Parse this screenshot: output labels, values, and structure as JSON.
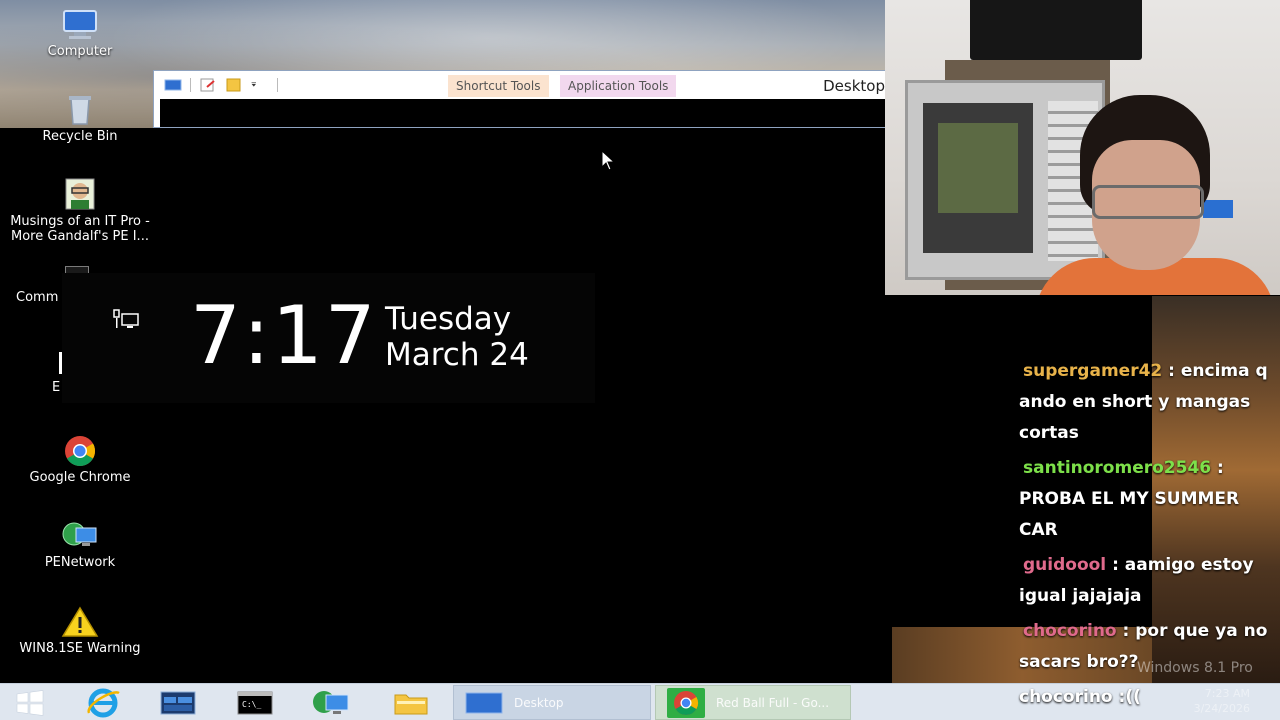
{
  "desktop_icons": {
    "computer": "Computer",
    "recycle_bin": "Recycle Bin",
    "musings": "Musings of an IT Pro - More Gandalf's PE I...",
    "commands": "Comm",
    "partial": "E",
    "chrome": "Google Chrome",
    "penetwork": "PENetwork",
    "warning": "WIN8.1SE Warning"
  },
  "explorer": {
    "shortcut_tools": "Shortcut Tools",
    "application_tools": "Application Tools",
    "title": "Desktop"
  },
  "clock": {
    "time": "7:17",
    "day": "Tuesday",
    "date": "March 24"
  },
  "chat": {
    "messages": [
      {
        "user": "supergamer42",
        "text": ": encima q ando en short y mangas cortas",
        "color": "#e8b34a"
      },
      {
        "user": "santinoromero2546",
        "text": ": PROBA EL MY SUMMER CAR",
        "color": "#7de04a"
      },
      {
        "user": "guidoool",
        "text": ": aamigo estoy igual jajajaja",
        "color": "#e06a8c"
      },
      {
        "user": "chocorino",
        "text": ": por que ya no sacars bro??",
        "color": "#e06a8c"
      }
    ],
    "last": "chocorino :(("
  },
  "watermark": "Windows 8.1 Pro",
  "taskbar": {
    "desktop_task": "Desktop",
    "chrome_task": "Red Ball Full - Go...",
    "tray_time": "7:23 AM",
    "tray_date": "3/24/2026"
  },
  "colors": {
    "taskbar": "#dfe6ef",
    "shortcut_tools_bg": "#fbe3cf",
    "application_tools_bg": "#f2d8ee"
  },
  "icons": [
    "computer-icon",
    "recycle-bin-icon",
    "avatar-icon",
    "cmd-icon",
    "chrome-icon",
    "network-icon",
    "warning-icon",
    "start-icon",
    "ie-icon",
    "folder-icon"
  ]
}
